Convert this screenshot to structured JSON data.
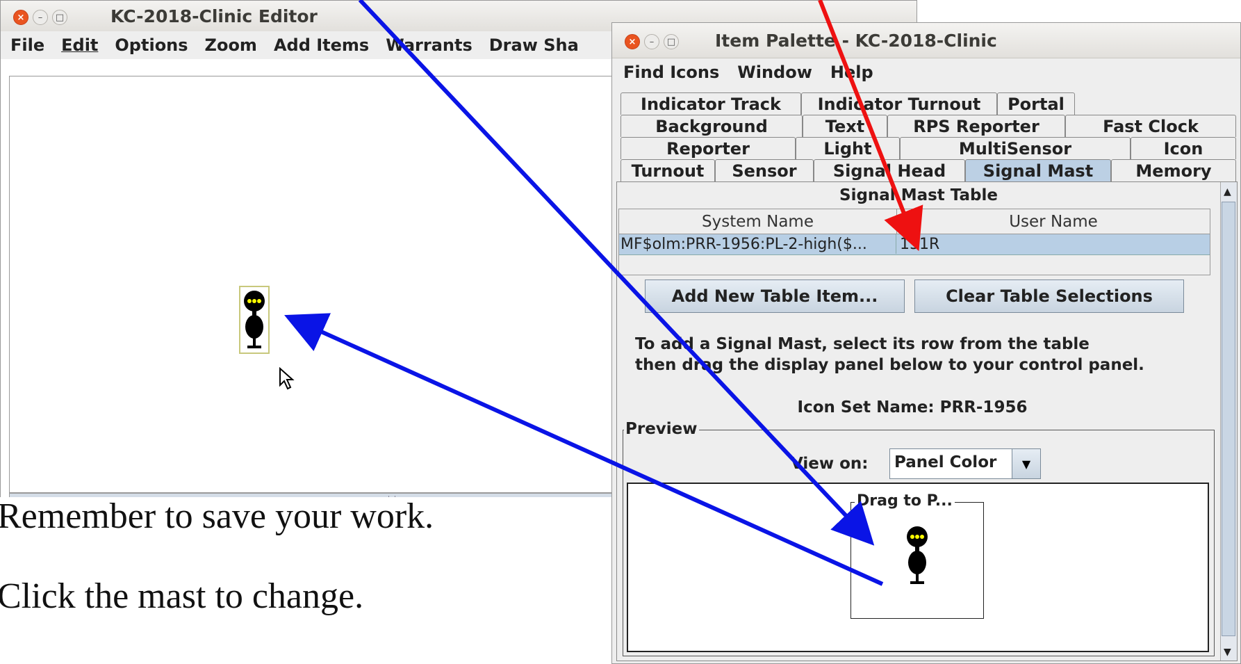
{
  "editor": {
    "title": "KC-2018-Clinic Editor",
    "menu": [
      "File",
      "Edit",
      "Options",
      "Zoom",
      "Add Items",
      "Warrants",
      "Draw Sha"
    ]
  },
  "palette": {
    "title": "Item Palette - KC-2018-Clinic",
    "menu": [
      "Find Icons",
      "Window",
      "Help"
    ],
    "tabs_row1": [
      "Indicator Track",
      "Indicator Turnout",
      "Portal"
    ],
    "tabs_row2": [
      "Background",
      "Text",
      "RPS Reporter",
      "Fast Clock"
    ],
    "tabs_row3": [
      "Reporter",
      "Light",
      "MultiSensor",
      "Icon"
    ],
    "tabs_row4": [
      "Turnout",
      "Sensor",
      "Signal Head",
      "Signal Mast",
      "Memory"
    ],
    "active_tab": "Signal Mast",
    "table_title": "Signal Mast Table",
    "columns": [
      "System Name",
      "User Name"
    ],
    "rows": [
      {
        "system": "MF$olm:PRR-1956:PL-2-high($...",
        "user": "151R"
      }
    ],
    "add_button": "Add New Table Item...",
    "clear_button": "Clear Table Selections",
    "instructions_line1": "To add a Signal Mast, select its row from the table",
    "instructions_line2": "then drag the display panel below to your control panel.",
    "icon_set": "Icon Set Name: PRR-1956",
    "preview_label": "Preview",
    "view_on_label": "View on:",
    "view_on_value": "Panel Color",
    "drag_label": "Drag to P..."
  },
  "notes": {
    "line1": "Remember to save your work.",
    "line2": "Click the mast to change."
  },
  "colors": {
    "arrow_blue": "#0a14e6",
    "arrow_red": "#ee1111",
    "selected_row": "#b8cfe5",
    "signal_lamp": "#ffff00"
  }
}
